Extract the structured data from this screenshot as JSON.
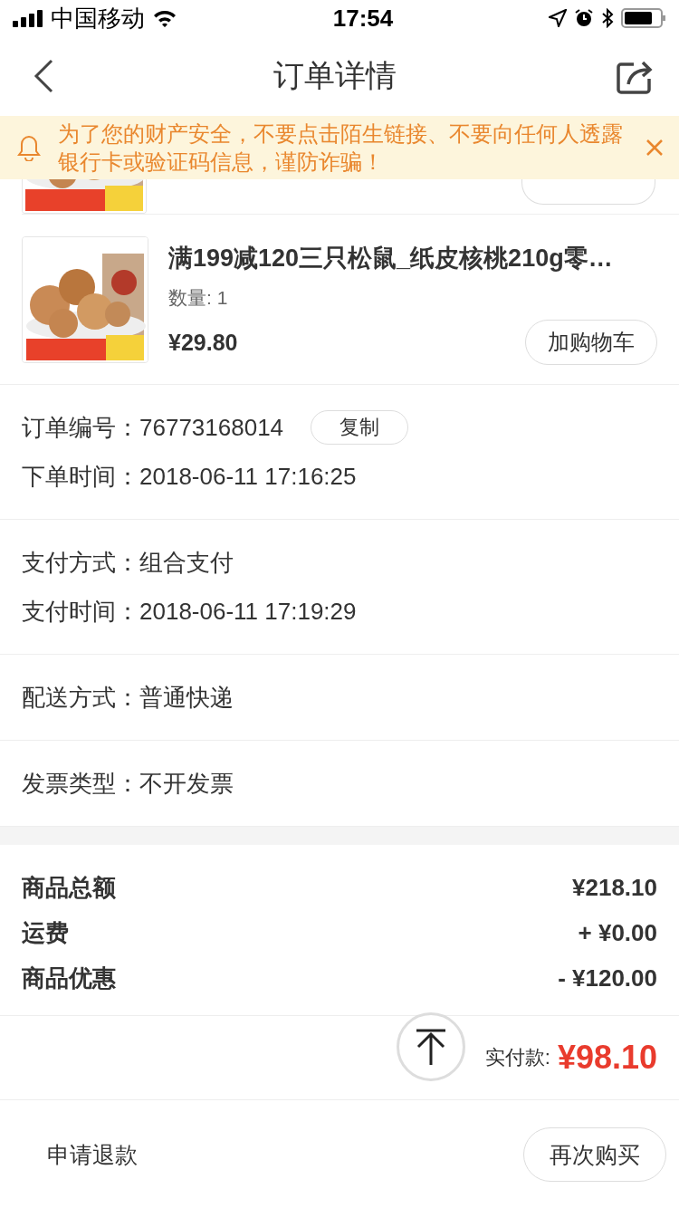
{
  "status_bar": {
    "carrier": "中国移动",
    "time": "17:54"
  },
  "nav": {
    "title": "订单详情"
  },
  "notice": {
    "text": "为了您的财产安全，不要点击陌生链接、不要向任何人透露银行卡或验证码信息，谨防诈骗！"
  },
  "products": [
    {
      "kind": "partial"
    },
    {
      "kind": "full",
      "name": "满199减120三只松鼠_纸皮核桃210g零…",
      "quantity": "数量: 1",
      "price": "¥29.80",
      "button": "加购物车"
    }
  ],
  "info_sections": [
    [
      {
        "label": "订单编号：",
        "value": "76773168014",
        "action": "复制"
      },
      {
        "label": "下单时间：",
        "value": "2018-06-11 17:16:25"
      }
    ],
    [
      {
        "label": "支付方式：",
        "value": "组合支付"
      },
      {
        "label": "支付时间：",
        "value": "2018-06-11 17:19:29"
      }
    ],
    [
      {
        "label": "配送方式：",
        "value": "普通快递"
      }
    ],
    [
      {
        "label": "发票类型：",
        "value": "不开发票"
      }
    ]
  ],
  "amounts": [
    {
      "label": "商品总额",
      "value": "¥218.10"
    },
    {
      "label": "运费",
      "value": "+ ¥0.00"
    },
    {
      "label": "商品优惠",
      "value": "- ¥120.00"
    }
  ],
  "total": {
    "label": "实付款:",
    "value": "¥98.10"
  },
  "bottom_bar": {
    "left": "申请退款",
    "right": "再次购买"
  }
}
